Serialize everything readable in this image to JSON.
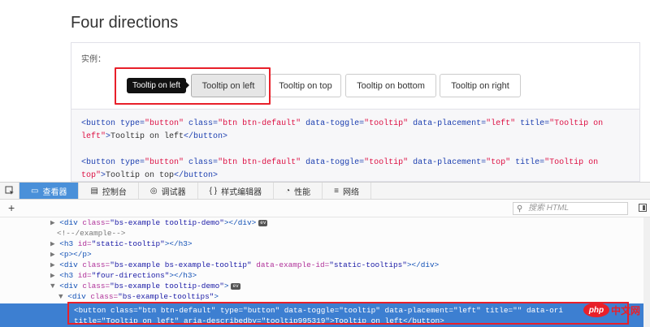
{
  "page": {
    "title": "Four directions",
    "demo_label": "实例：",
    "tooltip_text": "Tooltip on left",
    "buttons": [
      "Tooltip on left",
      "Tooltip on top",
      "Tooltip on bottom",
      "Tooltip on right"
    ],
    "code": {
      "l1_open": "<button",
      "l1_type_attr": " type=",
      "l1_type_val": "\"button\"",
      "l1_class_attr": " class=",
      "l1_class_val": "\"btn btn-default\"",
      "l1_toggle_attr": " data-toggle=",
      "l1_toggle_val": "\"tooltip\"",
      "l1_place_attr": " data-placement=",
      "l1_place_val": "\"left\"",
      "l1_title_attr": " title=",
      "l1_title_val": "\"Tooltip on",
      "l2_val": "left\"",
      "l2_gt": ">",
      "l2_text": "Tooltip on left",
      "l2_close": "</button>",
      "l3_place_val": "\"top\"",
      "l3_title_val": "\"Tooltip on",
      "l4_val": "top\"",
      "l4_text": "Tooltip on top"
    }
  },
  "devtools": {
    "tabs": [
      {
        "icon": "▭",
        "label": "查看器"
      },
      {
        "icon": "▤",
        "label": "控制台"
      },
      {
        "icon": "◎",
        "label": "调试器"
      },
      {
        "icon": "{ }",
        "label": "样式编辑器"
      },
      {
        "icon": "◔",
        "label": "性能"
      },
      {
        "icon": "≡",
        "label": "网络"
      }
    ],
    "search_placeholder": "搜索 HTML",
    "ev_badge": "ev",
    "tree": {
      "r1_attr_class": "class=",
      "r1_val": "\"bs-example tooltip-demo\"",
      "r2_comment": "<!--/example-->",
      "r3_attr": "id=",
      "r3_val": "\"static-tooltip\"",
      "r4_tag": "<p></p>",
      "r5_attr_class": "class=",
      "r5_val_class": "\"bs-example bs-example-tooltip\"",
      "r5_attr_id": "data-example-id=",
      "r5_val_id": "\"static-tooltips\"",
      "r6_attr": "id=",
      "r6_val": "\"four-directions\"",
      "r7_attr": "class=",
      "r7_val": "\"bs-example tooltip-demo\"",
      "r8_attr": "class=",
      "r8_val": "\"bs-example-tooltips\"",
      "sel_line1": "<button class=\"btn btn-default\" type=\"button\" data-toggle=\"tooltip\" data-placement=\"left\" title=\"\" data-ori",
      "sel_line2": "title=\"Tooltip on left\" aria-describedby=\"tooltip995319\">Tooltip on left</button>"
    }
  },
  "watermark": {
    "logo": "php",
    "text": "中文网"
  },
  "colors": {
    "accent": "#4a90d9",
    "highlight_border": "#e8202a",
    "selected_row": "#3d7fd1"
  }
}
